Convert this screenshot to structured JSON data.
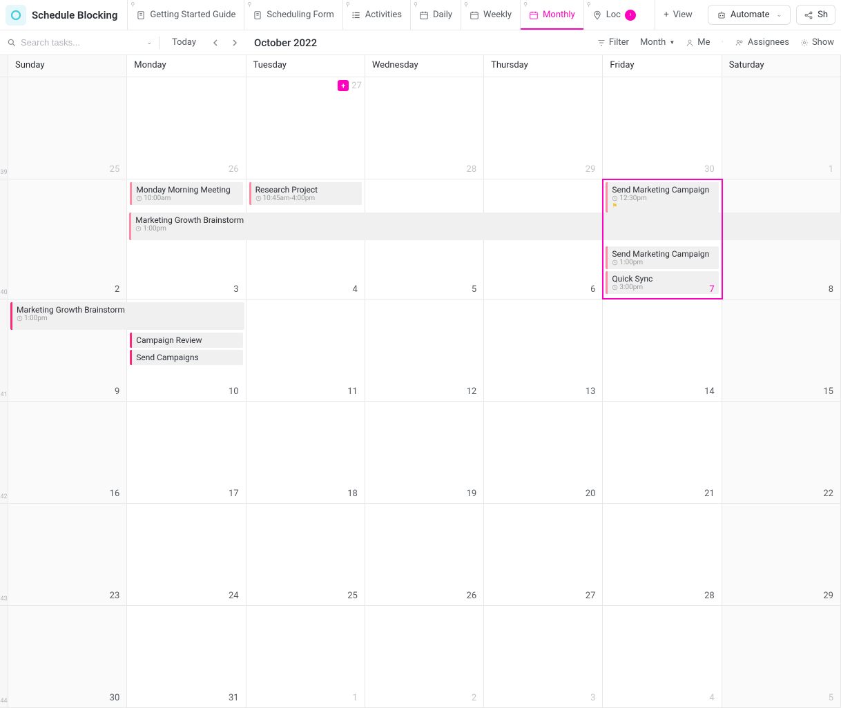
{
  "header": {
    "title": "Schedule Blocking",
    "tabs": [
      {
        "label": "Getting Started Guide",
        "icon": "doc"
      },
      {
        "label": "Scheduling Form",
        "icon": "doc"
      },
      {
        "label": "Activities",
        "icon": "list"
      },
      {
        "label": "Daily",
        "icon": "cal"
      },
      {
        "label": "Weekly",
        "icon": "cal"
      },
      {
        "label": "Monthly",
        "icon": "cal",
        "active": true
      },
      {
        "label": "Loc",
        "icon": "pin",
        "hasloc": true
      }
    ],
    "view_label": "View",
    "automate_label": "Automate",
    "share_label": "Sh"
  },
  "toolbar": {
    "search_placeholder": "Search tasks...",
    "today_label": "Today",
    "month_title": "October 2022",
    "filter_label": "Filter",
    "group_label": "Month",
    "me_label": "Me",
    "assignees_label": "Assignees",
    "show_label": "Show"
  },
  "day_names": [
    "Sunday",
    "Monday",
    "Tuesday",
    "Wednesday",
    "Thursday",
    "Friday",
    "Saturday"
  ],
  "weeks": [
    {
      "num": "39",
      "days": [
        {
          "d": "25",
          "other": true
        },
        {
          "d": "26",
          "other": true
        },
        {
          "d": "27",
          "other": true,
          "add": true
        },
        {
          "d": "28",
          "other": true
        },
        {
          "d": "29",
          "other": true
        },
        {
          "d": "30",
          "other": true
        },
        {
          "d": "1",
          "other": true
        }
      ]
    },
    {
      "num": "40",
      "days": [
        {
          "d": "2"
        },
        {
          "d": "3"
        },
        {
          "d": "4"
        },
        {
          "d": "5"
        },
        {
          "d": "6"
        },
        {
          "d": "7",
          "today": true
        },
        {
          "d": "8"
        }
      ]
    },
    {
      "num": "41",
      "days": [
        {
          "d": "9"
        },
        {
          "d": "10"
        },
        {
          "d": "11"
        },
        {
          "d": "12"
        },
        {
          "d": "13"
        },
        {
          "d": "14"
        },
        {
          "d": "15"
        }
      ]
    },
    {
      "num": "42",
      "days": [
        {
          "d": "16"
        },
        {
          "d": "17"
        },
        {
          "d": "18"
        },
        {
          "d": "19"
        },
        {
          "d": "20"
        },
        {
          "d": "21"
        },
        {
          "d": "22"
        }
      ]
    },
    {
      "num": "43",
      "days": [
        {
          "d": "23"
        },
        {
          "d": "24"
        },
        {
          "d": "25"
        },
        {
          "d": "26"
        },
        {
          "d": "27"
        },
        {
          "d": "28"
        },
        {
          "d": "29"
        }
      ]
    },
    {
      "num": "44",
      "days": [
        {
          "d": "30"
        },
        {
          "d": "31"
        },
        {
          "d": "1",
          "other": true
        },
        {
          "d": "2",
          "other": true
        },
        {
          "d": "3",
          "other": true
        },
        {
          "d": "4",
          "other": true
        },
        {
          "d": "5",
          "other": true
        }
      ]
    }
  ],
  "events": {
    "w1": {
      "mon": [
        {
          "title": "Monday Morning Meeting",
          "time": "10:00am"
        }
      ],
      "tue": [
        {
          "title": "Research Project",
          "time": "10:45am-4:00pm"
        }
      ],
      "fri": [
        {
          "title": "Send Marketing Campaign",
          "time": "12:30pm",
          "flag": true
        },
        {
          "title": "Send Marketing Campaign",
          "time": "1:00pm"
        },
        {
          "title": "Quick Sync",
          "time": "3:00pm"
        }
      ],
      "span": {
        "title": "Marketing Growth Brainstorm",
        "time": "1:00pm"
      }
    },
    "w2": {
      "span": {
        "title": "Marketing Growth Brainstorm",
        "time": "1:00pm"
      },
      "mon": [
        {
          "title": "Campaign Review",
          "strong": true
        },
        {
          "title": "Send Campaigns",
          "strong": true
        }
      ]
    }
  }
}
